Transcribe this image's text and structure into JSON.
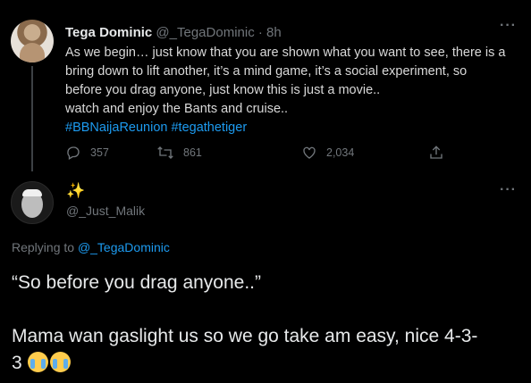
{
  "tweet": {
    "author_name": "Tega Dominic",
    "meta": "@_TegaDominic · 8h",
    "lines": [
      "As we begin… just know that you are shown what you want to see, there is a",
      "bring down to lift another, it’s a mind game, it’s a social experiment, so",
      "before you drag anyone, just know this is just a movie..",
      "watch and enjoy the Bants and cruise.."
    ],
    "hashtags": "#BBNaijaReunion #tegathetiger",
    "replies": "357",
    "retweets": "861",
    "likes": "2,034",
    "more": "···"
  },
  "reply": {
    "emoji_name": "✨",
    "handle": "@_Just_Malik",
    "replying_prefix": "Replying to",
    "replying_mention": "@_TegaDominic",
    "quote": "“So before you drag anyone..”",
    "line2": "Mama wan gaslight us so we go take am easy, nice 4-3-",
    "line3": "3",
    "more": "···"
  },
  "colors": {
    "background": "#000000",
    "accent": "#1d9bf0",
    "muted": "#71767b",
    "text": "#e7e9ea"
  },
  "icons": [
    "reply-icon",
    "retweet-icon",
    "like-icon",
    "share-icon",
    "more-icon",
    "crying-face-icon"
  ]
}
